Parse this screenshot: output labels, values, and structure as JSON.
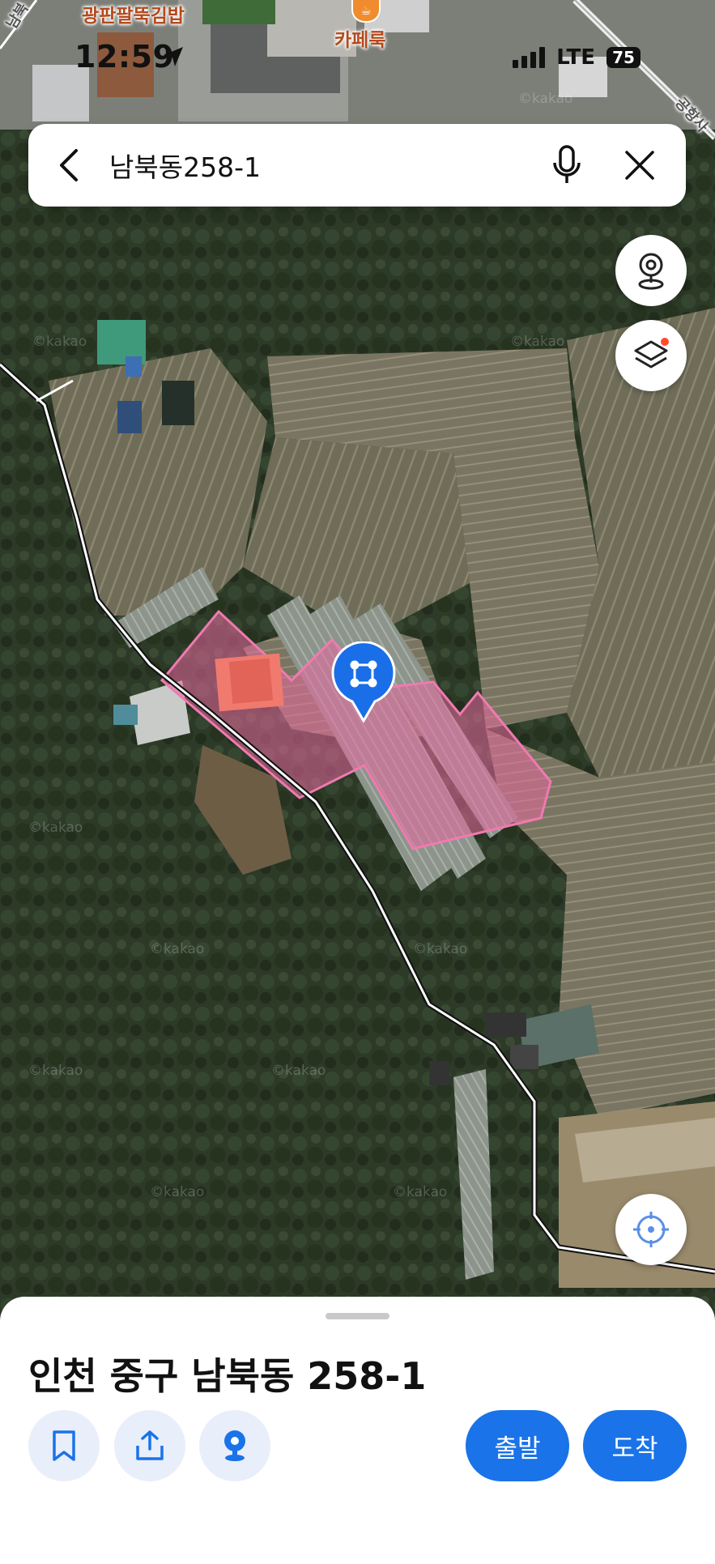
{
  "status_bar": {
    "time": "12:59",
    "network": "LTE",
    "battery": "75"
  },
  "map": {
    "labels": {
      "restaurant": "광판팔뚝김밥",
      "cafe": "카페룩",
      "road_top_left": "남북",
      "road_top_right": "공항사"
    },
    "watermark": "©kakao",
    "colors": {
      "parcel_fill": "#e8679e",
      "parcel_stroke": "#f07ab0",
      "pin": "#1a6ee8",
      "road": "#ffffff"
    }
  },
  "search": {
    "query": "남북동258-1",
    "back_icon": "chevron-left-icon",
    "mic_icon": "microphone-icon",
    "clear_icon": "close-icon"
  },
  "map_controls": {
    "roadview_icon": "roadview-icon",
    "layers_icon": "layers-icon",
    "locate_icon": "crosshair-icon"
  },
  "bottom_sheet": {
    "title": "인천 중구 남북동 258-1",
    "actions": {
      "bookmark_icon": "bookmark-icon",
      "share_icon": "share-icon",
      "roadview_icon": "roadview-icon"
    },
    "depart_label": "출발",
    "arrive_label": "도착",
    "accent_color": "#1a73e8"
  }
}
